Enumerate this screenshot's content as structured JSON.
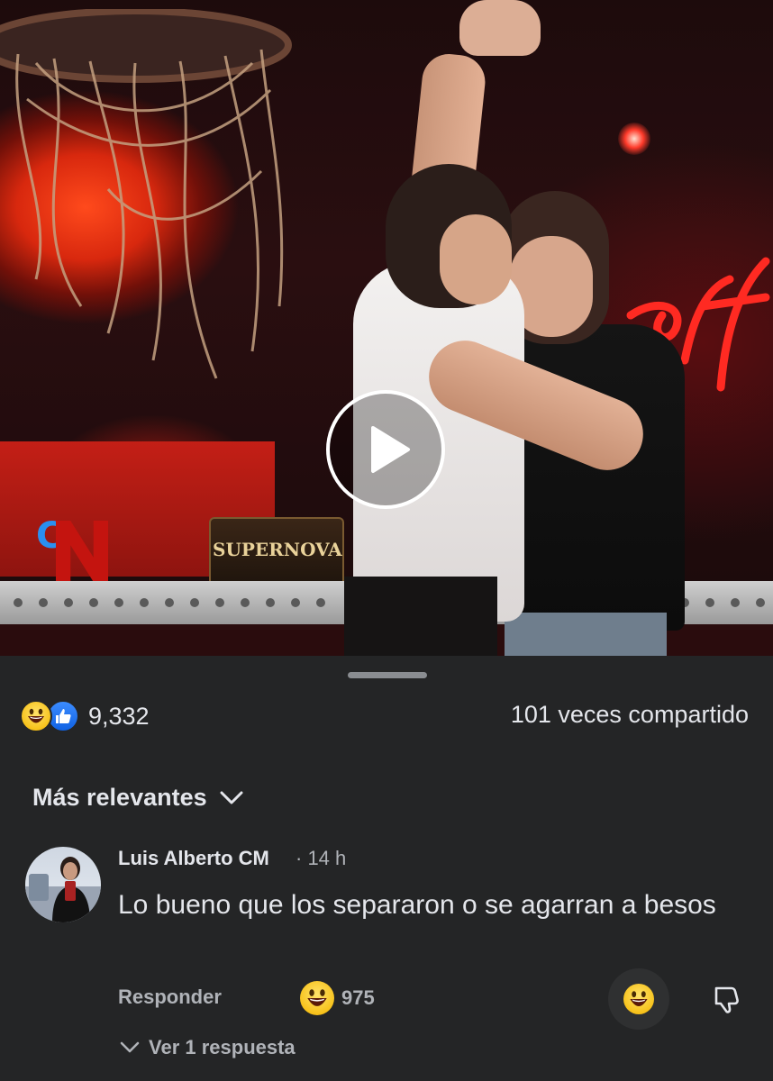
{
  "video": {
    "plaque_text": "SUPERNOVA",
    "play_icon": "play-icon"
  },
  "post_stats": {
    "reaction_icons": [
      "grinning-face-icon",
      "like-icon"
    ],
    "reaction_count": "9,332",
    "shares": "101 veces compartido"
  },
  "comments_header": {
    "sort_label": "Más relevantes",
    "sort_icon": "chevron-down-icon"
  },
  "comment": {
    "author": "Luis Alberto CM",
    "time": "· 14 h",
    "text": "Lo bueno que los separaron o se agarran a besos",
    "reply_label": "Responder",
    "reaction_icon": "grinning-face-icon",
    "reaction_count": "975",
    "view_replies_label": "Ver 1 respuesta"
  },
  "colors": {
    "sheet_background": "#242526",
    "primary_text": "#e4e6eb",
    "secondary_text": "#b0b3b8",
    "like_blue": "#1877f2",
    "emoji_yellow": "#f7c21b"
  }
}
